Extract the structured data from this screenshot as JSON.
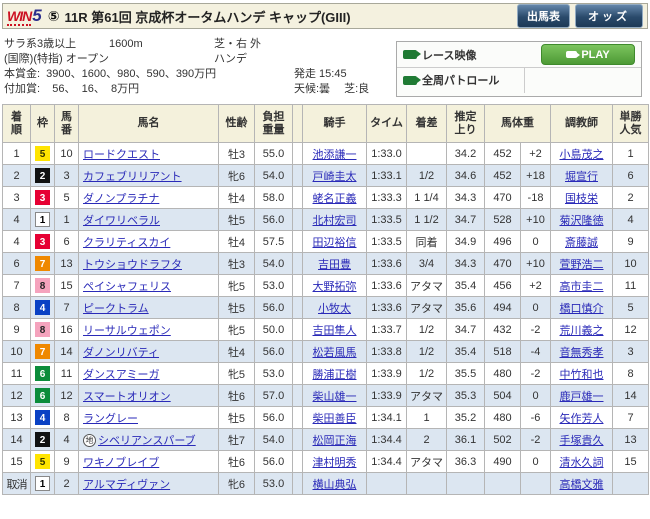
{
  "header": {
    "logo_win": "WIN",
    "logo_five": "5",
    "circled_number": "⑤",
    "title": "11R 第61回 京成杯オータムハンデ キャップ(GIII)",
    "shutsuba_button": "出馬表",
    "odds_button": "オッズ"
  },
  "race_info": {
    "class": "サラ系3歳以上",
    "distance": "1600m",
    "course": "芝・右 外",
    "conditions": "(国際)(特指) オープン",
    "weight_rule": "ハンデ",
    "prize_line": "本賞金:  3900、1600、980、590、390万円",
    "start_time": "発走 15:45",
    "fuka_line": "付加賞:    56、  16、  8万円",
    "weather_turf": "天候:曇　 芝:良"
  },
  "video_panel": {
    "race_video_label": "レース映像",
    "patrol_label": "全周パトロール",
    "play_label": "PLAY"
  },
  "colors": {
    "accent_navy": "#2a4a6b",
    "play_green": "#4d9a35",
    "link_blue": "#2a2ab8",
    "alt_row": "#dce6f1",
    "header_cream": "#f4f1dc"
  },
  "waku_colors": {
    "1": {
      "bg": "#ffffff",
      "fg": "#000000",
      "border": "#888888"
    },
    "2": {
      "bg": "#111111",
      "fg": "#ffffff"
    },
    "3": {
      "bg": "#e60033",
      "fg": "#ffffff"
    },
    "4": {
      "bg": "#0a41c4",
      "fg": "#ffffff"
    },
    "5": {
      "bg": "#ffe400",
      "fg": "#333300"
    },
    "6": {
      "bg": "#0b8c3a",
      "fg": "#ffffff"
    },
    "7": {
      "bg": "#ef8800",
      "fg": "#ffffff"
    },
    "8": {
      "bg": "#f5a3bd",
      "fg": "#222222"
    }
  },
  "table": {
    "headers": {
      "pos": "着\n順",
      "waku": "枠",
      "num": "馬\n番",
      "name": "馬名",
      "sexage": "性齢",
      "weight": "負担\n重量",
      "blinker": "",
      "jockey": "騎手",
      "time": "タイム",
      "margin": "着差",
      "agari": "推定\n上り",
      "hweight": "馬体重",
      "trainer": "調教師",
      "pop": "単勝\n人気"
    },
    "rows": [
      {
        "pos": "1",
        "waku": "5",
        "num": "10",
        "mark": "",
        "name": "ロードクエスト",
        "sexage": "牡3",
        "weight": "55.0",
        "jockey": "池添謙一",
        "time": "1:33.0",
        "margin": "",
        "agari": "34.2",
        "hweight": "452",
        "hdiff": "+2",
        "trainer": "小島茂之",
        "pop": "1"
      },
      {
        "pos": "2",
        "waku": "2",
        "num": "3",
        "mark": "",
        "name": "カフェブリリアント",
        "sexage": "牝6",
        "weight": "54.0",
        "jockey": "戸崎圭太",
        "time": "1:33.1",
        "margin": "1/2",
        "agari": "34.6",
        "hweight": "452",
        "hdiff": "+18",
        "trainer": "堀宣行",
        "pop": "6"
      },
      {
        "pos": "3",
        "waku": "3",
        "num": "5",
        "mark": "",
        "name": "ダノンプラチナ",
        "sexage": "牡4",
        "weight": "58.0",
        "jockey": "蛯名正義",
        "time": "1:33.3",
        "margin": "1 1/4",
        "agari": "34.3",
        "hweight": "470",
        "hdiff": "-18",
        "trainer": "国枝栄",
        "pop": "2"
      },
      {
        "pos": "4",
        "waku": "1",
        "num": "1",
        "mark": "",
        "name": "ダイワリベラル",
        "sexage": "牡5",
        "weight": "56.0",
        "jockey": "北村宏司",
        "time": "1:33.5",
        "margin": "1 1/2",
        "agari": "34.7",
        "hweight": "528",
        "hdiff": "+10",
        "trainer": "菊沢隆徳",
        "pop": "4"
      },
      {
        "pos": "4",
        "waku": "3",
        "num": "6",
        "mark": "",
        "name": "クラリティスカイ",
        "sexage": "牡4",
        "weight": "57.5",
        "jockey": "田辺裕信",
        "time": "1:33.5",
        "margin": "同着",
        "agari": "34.9",
        "hweight": "496",
        "hdiff": "0",
        "trainer": "斎藤誠",
        "pop": "9"
      },
      {
        "pos": "6",
        "waku": "7",
        "num": "13",
        "mark": "",
        "name": "トウショウドラフタ",
        "sexage": "牡3",
        "weight": "54.0",
        "jockey": "吉田豊",
        "time": "1:33.6",
        "margin": "3/4",
        "agari": "34.3",
        "hweight": "470",
        "hdiff": "+10",
        "trainer": "萱野浩二",
        "pop": "10"
      },
      {
        "pos": "7",
        "waku": "8",
        "num": "15",
        "mark": "",
        "name": "ペイシャフェリス",
        "sexage": "牝5",
        "weight": "53.0",
        "jockey": "大野拓弥",
        "time": "1:33.6",
        "margin": "アタマ",
        "agari": "35.4",
        "hweight": "456",
        "hdiff": "+2",
        "trainer": "高市圭二",
        "pop": "11"
      },
      {
        "pos": "8",
        "waku": "4",
        "num": "7",
        "mark": "",
        "name": "ピークトラム",
        "sexage": "牡5",
        "weight": "56.0",
        "jockey": "小牧太",
        "time": "1:33.6",
        "margin": "アタマ",
        "agari": "35.6",
        "hweight": "494",
        "hdiff": "0",
        "trainer": "橋口慎介",
        "pop": "5"
      },
      {
        "pos": "9",
        "waku": "8",
        "num": "16",
        "mark": "",
        "name": "リーサルウェポン",
        "sexage": "牝5",
        "weight": "50.0",
        "jockey": "吉田隼人",
        "time": "1:33.7",
        "margin": "1/2",
        "agari": "34.7",
        "hweight": "432",
        "hdiff": "-2",
        "trainer": "荒川義之",
        "pop": "12"
      },
      {
        "pos": "10",
        "waku": "7",
        "num": "14",
        "mark": "",
        "name": "ダノンリバティ",
        "sexage": "牡4",
        "weight": "56.0",
        "jockey": "松若風馬",
        "time": "1:33.8",
        "margin": "1/2",
        "agari": "35.4",
        "hweight": "518",
        "hdiff": "-4",
        "trainer": "音無秀孝",
        "pop": "3"
      },
      {
        "pos": "11",
        "waku": "6",
        "num": "11",
        "mark": "",
        "name": "ダンスアミーガ",
        "sexage": "牝5",
        "weight": "53.0",
        "jockey": "勝浦正樹",
        "time": "1:33.9",
        "margin": "1/2",
        "agari": "35.5",
        "hweight": "480",
        "hdiff": "-2",
        "trainer": "中竹和也",
        "pop": "8"
      },
      {
        "pos": "12",
        "waku": "6",
        "num": "12",
        "mark": "",
        "name": "スマートオリオン",
        "sexage": "牡6",
        "weight": "57.0",
        "jockey": "柴山雄一",
        "time": "1:33.9",
        "margin": "アタマ",
        "agari": "35.3",
        "hweight": "504",
        "hdiff": "0",
        "trainer": "鹿戸雄一",
        "pop": "14"
      },
      {
        "pos": "13",
        "waku": "4",
        "num": "8",
        "mark": "",
        "name": "ラングレー",
        "sexage": "牡5",
        "weight": "56.0",
        "jockey": "柴田善臣",
        "time": "1:34.1",
        "margin": "1",
        "agari": "35.2",
        "hweight": "480",
        "hdiff": "-6",
        "trainer": "矢作芳人",
        "pop": "7"
      },
      {
        "pos": "14",
        "waku": "2",
        "num": "4",
        "mark": "地",
        "name": "シベリアンスパーブ",
        "sexage": "牡7",
        "weight": "54.0",
        "jockey": "松岡正海",
        "time": "1:34.4",
        "margin": "2",
        "agari": "36.1",
        "hweight": "502",
        "hdiff": "-2",
        "trainer": "手塚貴久",
        "pop": "13"
      },
      {
        "pos": "15",
        "waku": "5",
        "num": "9",
        "mark": "",
        "name": "ワキノブレイブ",
        "sexage": "牡6",
        "weight": "56.0",
        "jockey": "津村明秀",
        "time": "1:34.4",
        "margin": "アタマ",
        "agari": "36.3",
        "hweight": "490",
        "hdiff": "0",
        "trainer": "清水久詞",
        "pop": "15"
      },
      {
        "pos": "取消",
        "waku": "1",
        "num": "2",
        "mark": "",
        "name": "アルマディヴァン",
        "sexage": "牝6",
        "weight": "53.0",
        "jockey": "横山典弘",
        "time": "",
        "margin": "",
        "agari": "",
        "hweight": "",
        "hdiff": "",
        "trainer": "高橋文雅",
        "pop": ""
      }
    ]
  }
}
